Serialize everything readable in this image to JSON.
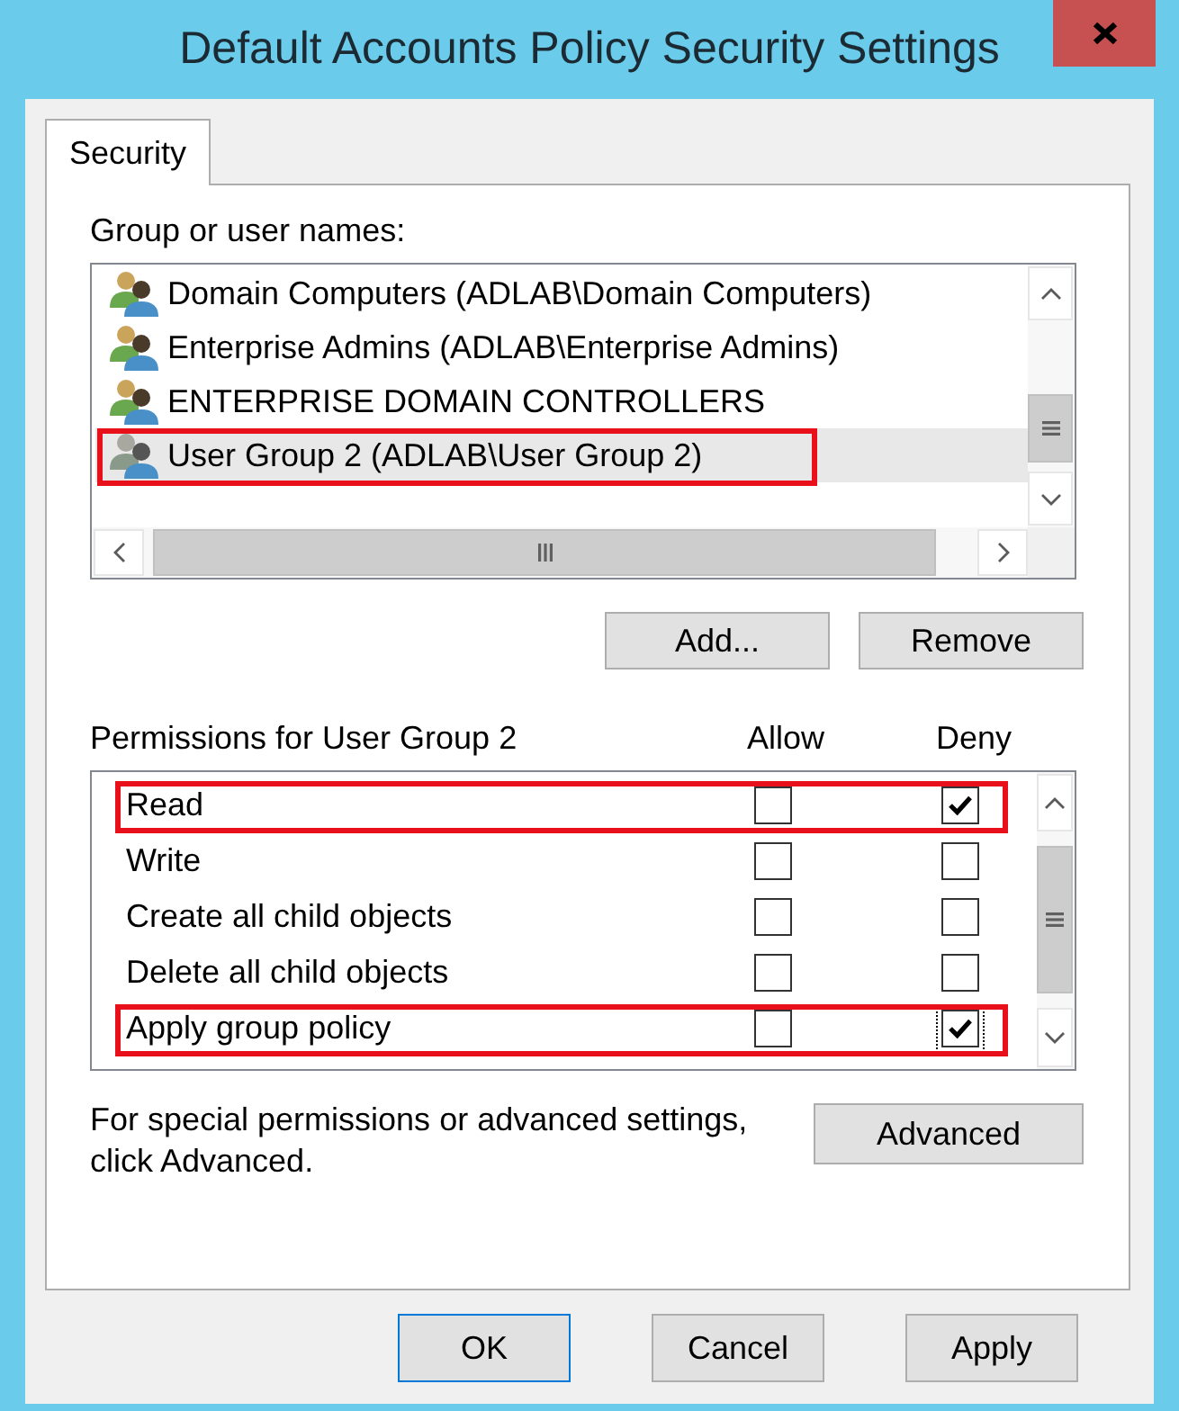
{
  "window": {
    "title": "Default Accounts Policy Security Settings"
  },
  "tabs": [
    {
      "label": "Security",
      "selected": true
    }
  ],
  "group_list": {
    "label": "Group or user names:",
    "items": [
      {
        "name": "Domain Computers (ADLAB\\Domain Computers)",
        "selected": false,
        "highlighted": false
      },
      {
        "name": "Enterprise Admins (ADLAB\\Enterprise Admins)",
        "selected": false,
        "highlighted": false
      },
      {
        "name": "ENTERPRISE DOMAIN CONTROLLERS",
        "selected": false,
        "highlighted": false
      },
      {
        "name": "User Group 2 (ADLAB\\User Group 2)",
        "selected": true,
        "highlighted": true
      }
    ]
  },
  "group_buttons": [
    "Add...",
    "Remove"
  ],
  "permissions": {
    "label": "Permissions for User Group 2",
    "columns": [
      "Allow",
      "Deny"
    ],
    "rows": [
      {
        "name": "Read",
        "highlighted": true,
        "allow": {
          "checked": false,
          "focused": false
        },
        "deny": {
          "checked": true,
          "focused": false
        }
      },
      {
        "name": "Write",
        "highlighted": false,
        "allow": {
          "checked": false,
          "focused": false
        },
        "deny": {
          "checked": false,
          "focused": false
        }
      },
      {
        "name": "Create all child objects",
        "highlighted": false,
        "allow": {
          "checked": false,
          "focused": false
        },
        "deny": {
          "checked": false,
          "focused": false
        }
      },
      {
        "name": "Delete all child objects",
        "highlighted": false,
        "allow": {
          "checked": false,
          "focused": false
        },
        "deny": {
          "checked": false,
          "focused": false
        }
      },
      {
        "name": "Apply group policy",
        "highlighted": true,
        "allow": {
          "checked": false,
          "focused": false
        },
        "deny": {
          "checked": true,
          "focused": true
        }
      }
    ]
  },
  "advanced": {
    "text": "For special permissions or advanced settings, click Advanced.",
    "button": "Advanced"
  },
  "dialog_buttons": [
    {
      "label": "OK",
      "default": true
    },
    {
      "label": "Cancel",
      "default": false
    },
    {
      "label": "Apply",
      "default": false
    }
  ]
}
